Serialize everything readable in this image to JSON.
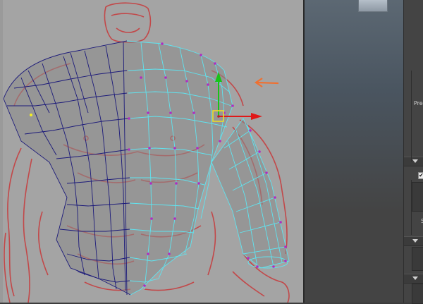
{
  "attribute_editor": {
    "labels": [
      "Pre",
      "S"
    ]
  },
  "checkbox": {
    "mark": "✔"
  },
  "colors": {
    "viewport_bg": "#a4a4a4",
    "sketch_red": "#c8383a",
    "wire_selected": "#5fe4f0",
    "wire_unselected": "#1c1a7a",
    "vertex": "#b02cc2",
    "manipulator_y": "#18c418",
    "manipulator_x": "#e01818",
    "arrow_annotation": "#f07030"
  },
  "icons": [
    "move-manipulator-icon",
    "annotation-arrow-icon",
    "collapse-triangle-icon"
  ]
}
